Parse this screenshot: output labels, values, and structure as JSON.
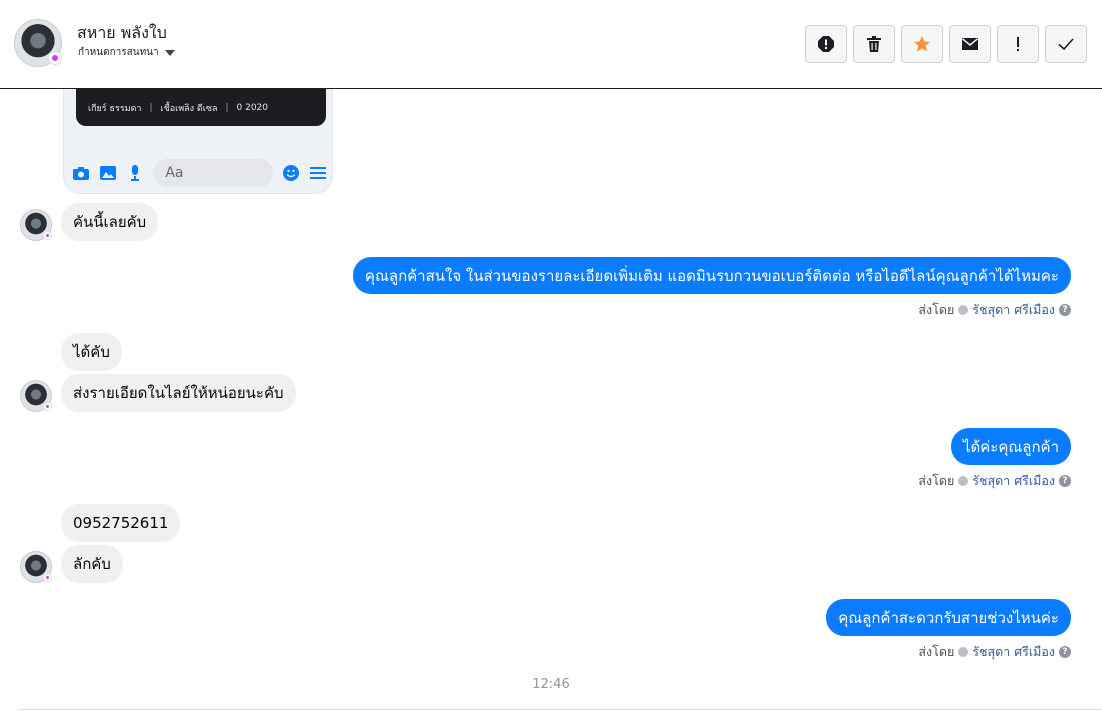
{
  "header": {
    "contact_name": "สหาย พลังใบ",
    "conversation_settings": "กำหนดการสนทนา",
    "toolbar": [
      {
        "name": "alert-icon",
        "label": "Alert"
      },
      {
        "name": "trash-icon",
        "label": "Delete"
      },
      {
        "name": "star-icon",
        "label": "Star"
      },
      {
        "name": "envelope-icon",
        "label": "Mark unread"
      },
      {
        "name": "exclamation-icon",
        "label": "Spam"
      },
      {
        "name": "check-icon",
        "label": "Done"
      }
    ]
  },
  "card": {
    "spec_gear": "เกียร์ ธรรมดา",
    "spec_fuel": "เชื้อเพลิง ดีเซล",
    "spec_year": "0 2020",
    "composer_placeholder": "Aa"
  },
  "messages": [
    {
      "dir": "in",
      "text": "คันนี้เลยคับ"
    },
    {
      "dir": "out",
      "text": "คุณลูกค้าสนใจ ในส่วนของรายละเอียดเพิ่มเติม แอดมินรบกวนขอเบอร์ติดต่อ หรือไอดีไลน์คุณลูกค้าได้ไหมคะ"
    },
    {
      "dir": "in",
      "text": "ได้คับ"
    },
    {
      "dir": "in",
      "text": "ส่งรายเอียดในไลย์ให้หน่อยนะคับ"
    },
    {
      "dir": "out",
      "text": "ได้ค่ะคุณลูกค้า"
    },
    {
      "dir": "in",
      "text": "0952752611"
    },
    {
      "dir": "in",
      "text": "ลักคับ"
    },
    {
      "dir": "out",
      "text": "คุณลูกค้าสะดวกรับสายช่วงไหนค่ะ"
    }
  ],
  "sent_by": {
    "prefix": "ส่งโดย",
    "agent": "รัชสุดา ศรีเมือง"
  },
  "timestamp": "12:46",
  "colors": {
    "outgoing_bubble": "#0a7cff",
    "incoming_bubble": "#f0f0f0",
    "star": "#f7923a"
  }
}
